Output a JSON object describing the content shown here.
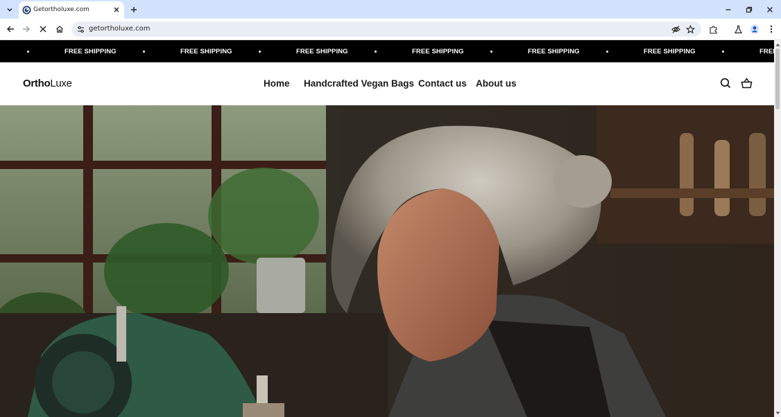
{
  "browser": {
    "tab": {
      "title": "Getortholuxe.com"
    },
    "url": "getortholuxe.com"
  },
  "site": {
    "announcement": {
      "text": "FREE SHIPPING"
    },
    "logo": {
      "bold": "Ortho",
      "regular": "Luxe"
    },
    "nav": [
      {
        "label": "Home"
      },
      {
        "label": "Handcrafted Vegan Bags"
      },
      {
        "label": "Contact us"
      },
      {
        "label": "About us"
      }
    ],
    "hero": {}
  },
  "icons": {
    "tab_list": "chevron-down-icon",
    "favicon": "site-favicon-icon",
    "tab_close": "close-icon",
    "new_tab": "plus-icon",
    "minimize": "minimize-icon",
    "restore": "restore-icon",
    "close": "close-icon",
    "back": "back-arrow-icon",
    "forward": "forward-arrow-icon",
    "stop": "stop-loading-icon",
    "home": "home-icon",
    "site_info": "tune-icon",
    "eye_off": "eye-off-icon",
    "bookmark": "star-icon",
    "extensions": "puzzle-icon",
    "labs": "flask-icon",
    "profile": "profile-icon",
    "menu": "kebab-menu-icon",
    "search": "search-icon",
    "cart": "basket-icon"
  },
  "colors": {
    "tabbar_bg": "#d3e3fd",
    "announcement_bg": "#000000",
    "announcement_text": "#ffffff",
    "nav_text": "#1a1a1a",
    "profile_blue": "#1a56c4"
  }
}
